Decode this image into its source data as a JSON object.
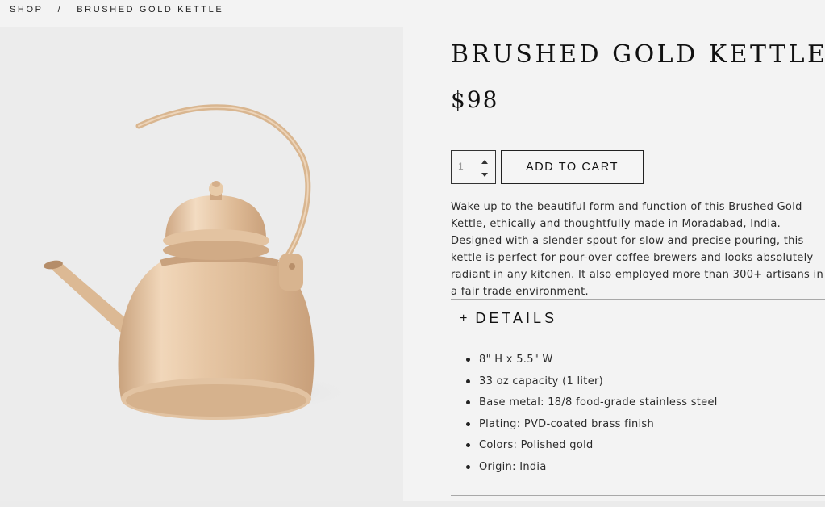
{
  "breadcrumb": {
    "shop": "SHOP",
    "separator": "/",
    "current": "BRUSHED GOLD KETTLE"
  },
  "product": {
    "image_alt": "Brushed gold kettle",
    "title": "BRUSHED GOLD KETTLE",
    "price": "$98",
    "quantity": "1",
    "add_to_cart": "ADD TO CART",
    "description": "Wake up to the beautiful form and function of this Brushed Gold Kettle, ethically and thoughtfully made in Moradabad, India. Designed with a slender spout for slow and precise pouring, this kettle is perfect for pour-over coffee brewers and looks absolutely radiant in any kitchen. It also employed more than 300+ artisans in a fair trade environment."
  },
  "details": {
    "toggle_icon": "+",
    "label": "DETAILS",
    "items": [
      "8\" H x 5.5\" W",
      "33 oz capacity (1 liter)",
      "Base metal: 18/8 food-grade stainless steel",
      "Plating: PVD-coated brass finish",
      "Colors: Polished gold",
      "Origin: India"
    ]
  },
  "colors": {
    "background": "#f3f3f3",
    "image_background": "#ececec",
    "kettle_gold": "#e3c2a0",
    "text": "#1a1a1a"
  },
  "icons": {
    "quantity_up": "caret-up-icon",
    "quantity_down": "caret-down-icon",
    "details_toggle": "plus-icon"
  }
}
